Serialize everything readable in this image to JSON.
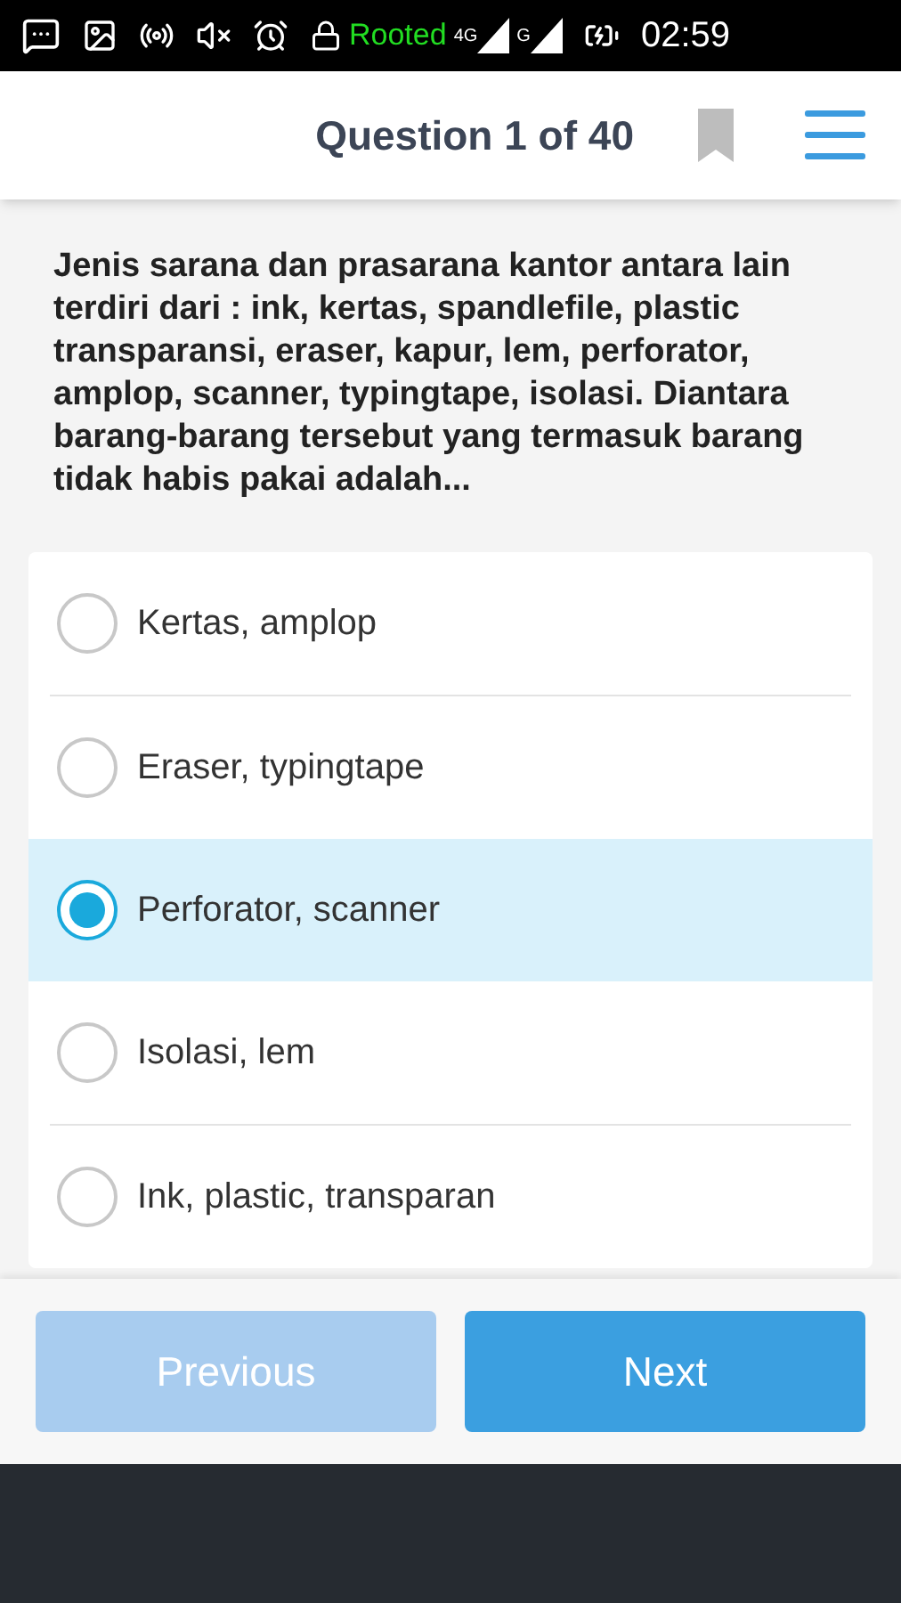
{
  "status_bar": {
    "root_label": "Rooted",
    "network_label": "4G",
    "signal_label": "G",
    "time": "02:59"
  },
  "header": {
    "title": "Question 1 of 40",
    "bookmarked": false
  },
  "question": "Jenis sarana dan prasarana kantor antara lain terdiri dari : ink, kertas, spandlefile, plastic transparansi, eraser, kapur, lem, perforator, amplop, scanner, typingtape, isolasi. Diantara barang-barang tersebut yang termasuk barang tidak habis pakai adalah...",
  "options": [
    {
      "label": "Kertas, amplop",
      "selected": false
    },
    {
      "label": "Eraser, typingtape",
      "selected": false
    },
    {
      "label": "Perforator, scanner",
      "selected": true
    },
    {
      "label": "Isolasi, lem",
      "selected": false
    },
    {
      "label": "Ink, plastic, transparan",
      "selected": false
    }
  ],
  "buttons": [
    {
      "label": "Previous",
      "disabled": true
    },
    {
      "label": "Next",
      "disabled": false
    }
  ]
}
